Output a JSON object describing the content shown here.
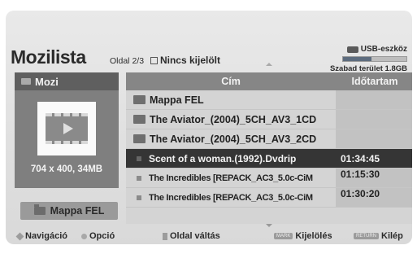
{
  "header": {
    "title": "Mozilista",
    "page_label": "Oldal",
    "page_value": "2/3",
    "marked_label": "Nincs kijelölt"
  },
  "usb": {
    "label": "USB-eszköz",
    "free_label": "Szabad terület 1.8GB",
    "usage_fraction": 0.45
  },
  "preview": {
    "heading": "Mozi",
    "resolution": "704 x 400, 34MB",
    "up_button": "Mappa FEL"
  },
  "table": {
    "headers": {
      "title": "Cím",
      "duration": "Időtartam"
    },
    "rows": [
      {
        "type": "folder",
        "name": "Mappa FEL",
        "duration": ""
      },
      {
        "type": "folder",
        "name": "The Aviator_(2004)_5CH_AV3_1CD",
        "duration": ""
      },
      {
        "type": "folder",
        "name": "The Aviator_(2004)_5CH_AV3_2CD",
        "duration": ""
      },
      {
        "type": "file",
        "name": "Scent of a woman.(1992).Dvdrip",
        "duration": "01:34:45",
        "selected": true
      },
      {
        "type": "file",
        "name": "The Incredibles [REPACK_AC3_5.0c-CiM",
        "duration": "01:15:30"
      },
      {
        "type": "file",
        "name": "The Incredibles [REPACK_AC3_5.0c-CiM",
        "duration": "01:30:20"
      }
    ]
  },
  "footer": {
    "navigation": "Navigáció",
    "option": "Opció",
    "page_switch": "Oldal váltás",
    "mark_tag": "MARK",
    "mark": "Kijelölés",
    "return_tag": "RETURN",
    "exit": "Kilép"
  }
}
